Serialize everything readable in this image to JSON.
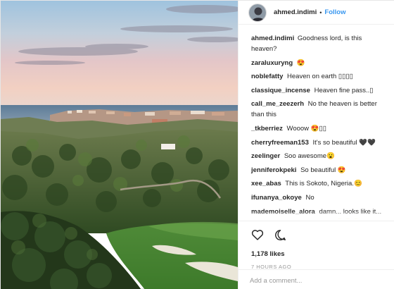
{
  "header": {
    "username": "ahmed.indimi",
    "separator": "•",
    "follow_label": "Follow"
  },
  "comments": [
    {
      "user": "ahmed.indimi",
      "text": "Goodness lord, is this heaven?"
    },
    {
      "user": "zaraluxuryng",
      "text": "😍"
    },
    {
      "user": "noblefatty",
      "text": "Heaven on earth ▯▯▯▯"
    },
    {
      "user": "classique_incense",
      "text": "Heaven fine pass..▯"
    },
    {
      "user": "call_me_zeezerh",
      "text": "No the heaven is better than this"
    },
    {
      "user": "_tkberriez",
      "text": "Wooow 😍▯▯"
    },
    {
      "user": "cherryfreeman153",
      "text": "It's so beautiful 🖤🖤"
    },
    {
      "user": "zeelinger",
      "text": "Soo awesome😮"
    },
    {
      "user": "jenniferokpeki",
      "text": "So beautiful 😍"
    },
    {
      "user": "xee_abas",
      "text": "This is Sokoto, Nigeria.😊"
    },
    {
      "user": "ifunanya_okoye",
      "text": "No"
    },
    {
      "user": "mademoiselle_alora",
      "text": "damn... looks like it... What I'd give to get this view😍😍😍... Staring at it while sipping a cup of coffee"
    }
  ],
  "actions": {
    "like_icon": "heart-icon",
    "comment_icon": "comment-bubble-icon",
    "likes_text": "1,178 likes",
    "time_text": "7 HOURS AGO"
  },
  "add_comment": {
    "placeholder": "Add a comment..."
  },
  "colors": {
    "link_blue": "#3897f0",
    "text": "#262626",
    "muted": "#999999",
    "border": "#efefef"
  }
}
